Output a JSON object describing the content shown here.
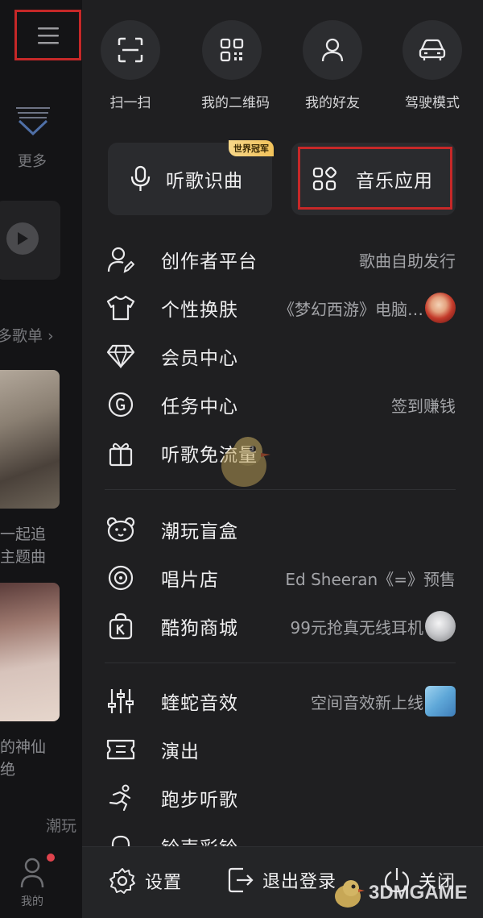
{
  "left_strip": {
    "more_label": "更多",
    "playlist_label": "多歌单 ›",
    "item1_line1": "一起追",
    "item1_line2": "主题曲",
    "item2_line1": "的神仙",
    "item2_line2": "绝",
    "trend_label": "潮玩",
    "me_label": "我的"
  },
  "quick_actions": [
    {
      "label": "扫一扫",
      "icon": "scan-icon"
    },
    {
      "label": "我的二维码",
      "icon": "qrcode-icon"
    },
    {
      "label": "我的好友",
      "icon": "friend-icon"
    },
    {
      "label": "驾驶模式",
      "icon": "car-icon"
    }
  ],
  "cards": {
    "listen_recognize": {
      "label": "听歌识曲",
      "badge": "世界冠军"
    },
    "music_apps": {
      "label": "音乐应用"
    }
  },
  "menu": [
    {
      "label": "创作者平台",
      "value": "歌曲自助发行"
    },
    {
      "label": "个性换肤",
      "value": "《梦幻西游》电脑…"
    },
    {
      "label": "会员中心",
      "value": ""
    },
    {
      "label": "任务中心",
      "value": "签到赚钱"
    },
    {
      "label": "听歌免流量",
      "value": ""
    },
    {
      "label": "潮玩盲盒",
      "value": ""
    },
    {
      "label": "唱片店",
      "value": "Ed Sheeran《=》预售"
    },
    {
      "label": "酷狗商城",
      "value": "99元抢真无线耳机"
    },
    {
      "label": "蝰蛇音效",
      "value": "空间音效新上线"
    },
    {
      "label": "演出",
      "value": ""
    },
    {
      "label": "跑步听歌",
      "value": ""
    },
    {
      "label": "铃声彩铃",
      "value": ""
    }
  ],
  "bottom": {
    "settings": "设置",
    "logout": "退出登录",
    "close": "关闭"
  },
  "watermark": "3DMGAME",
  "colors": {
    "background": "#1f1f21",
    "card": "#2a2b2e",
    "highlight_border": "#c62828",
    "badge_gold": "#f1c25a"
  }
}
